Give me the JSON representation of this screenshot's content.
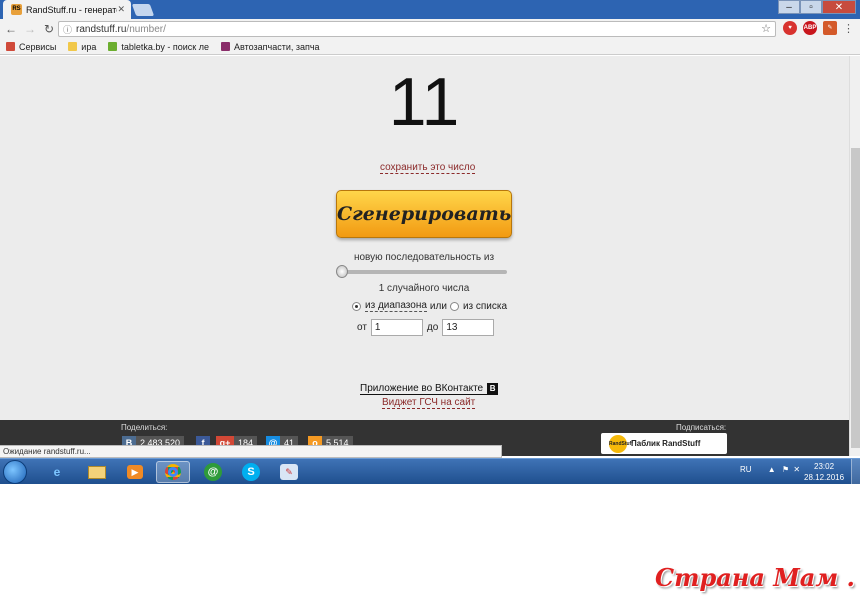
{
  "browser": {
    "tab_title": "RandStuff.ru - генератор с",
    "favicon_text": "RS",
    "url_domain": "randstuff.ru",
    "url_path": "/number/",
    "bookmarks": [
      {
        "label": "Сервисы",
        "icon": "apps-grid-icon",
        "color": "#d04a3a"
      },
      {
        "label": "ира",
        "icon": "folder-icon",
        "color": "#f1c84a"
      },
      {
        "label": "tabletka.by - поиск ле",
        "icon": "tabletka-icon",
        "color": "#6cae2f"
      },
      {
        "label": "Автозапчасти, запча",
        "icon": "autoparts-icon",
        "color": "#8a2d6a"
      }
    ],
    "extensions": [
      {
        "label": "",
        "color": "#d8332f"
      },
      {
        "label": "ABP",
        "color": "#c8161d"
      },
      {
        "label": "",
        "color": "#d45a2a"
      }
    ]
  },
  "page": {
    "number": "11",
    "save_link": "сохранить это число",
    "generate_button": "Сгенерировать",
    "sequence_label": "новую последовательность из",
    "slider_value": 1,
    "count_label": "1 случайного числа",
    "radio_range": "из диапазона",
    "radio_or": "или",
    "radio_list": "из списка",
    "from_label": "от",
    "from_value": "1",
    "to_label": "до",
    "to_value": "13",
    "vk_app_link": "Приложение во ВКонтакте",
    "widget_link": "Виджет ГСЧ на сайт"
  },
  "footer": {
    "share_label": "Поделиться:",
    "subscribe_label": "Подписаться:",
    "shares": [
      {
        "network": "vk",
        "icon": "В",
        "count": "2 483 520",
        "color": "#4c6c91"
      },
      {
        "network": "facebook",
        "icon": "f",
        "count": "",
        "color": "#3b5998"
      },
      {
        "network": "google-plus",
        "icon": "g+",
        "count": "184",
        "color": "#d34836"
      },
      {
        "network": "mailru",
        "icon": "@",
        "count": "41",
        "color": "#168de2"
      },
      {
        "network": "odnoklassniki",
        "icon": "о",
        "count": "5 514",
        "color": "#f59a23"
      }
    ],
    "public_label": "Паблик RandStuff",
    "public_icon_text": "RandStuff"
  },
  "status_text": "Ожидание randstuff.ru...",
  "taskbar": {
    "language": "RU",
    "time": "23:02",
    "date": "28.12.2016"
  },
  "watermark": "Страна Мам . ру"
}
